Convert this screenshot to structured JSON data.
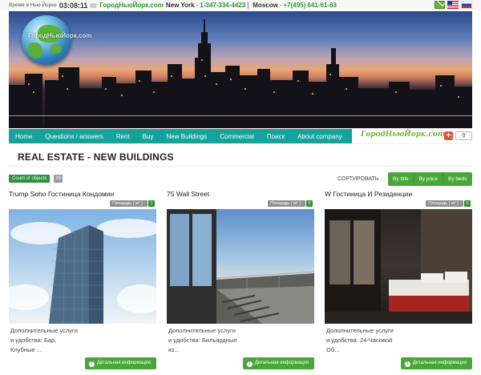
{
  "topbar": {
    "time_label": "Время в Нью Йорке",
    "time": "03:08:11",
    "site": "ГородНьюЙорк.com",
    "city1": "New York",
    "phone1": "1-347-334-4423",
    "separator": "|",
    "city2": "Moscow",
    "phone2": "+7(495) 641-61-63"
  },
  "banner": {
    "logo_text": "ГородНьюЙорк.com"
  },
  "nav": {
    "items": [
      "Home",
      "Questions / answers",
      "Rent",
      "Buy",
      "New Buildings",
      "Commercial",
      "Поиск",
      "About company"
    ],
    "brand": "ГородНьюЙорк.com",
    "plus": "+",
    "count": "0"
  },
  "page": {
    "heading": "REAL ESTATE - NEW BUILDINGS",
    "count_label": "Count of objects",
    "count_value": "29",
    "sort_label": "СОРТИРОВАТЬ :",
    "sort_buttons": [
      "By title",
      "By price",
      "By beds"
    ]
  },
  "cards": [
    {
      "title": "Trump Soho Гостиница Кондомин",
      "area_label": "Площадь ( м² ) :",
      "area_value": "1",
      "desc1": "Дополнительные услуги",
      "desc2": "и удобства: Бар,",
      "desc3": "Клубные ...",
      "details": "Детальная информация"
    },
    {
      "title": "75 Wall Street",
      "area_label": "Площадь ( м² ) :",
      "area_value": "0",
      "desc1": "Дополнительные услуги",
      "desc2": "и удобства: Бильярдные",
      "desc3": "ко...",
      "details": "Детальная информация"
    },
    {
      "title": "W Гостиница И Резиденции",
      "area_label": "Площадь ( м² ) :",
      "area_value": "0",
      "desc1": "Дополнительные услуги",
      "desc2": "и удобства: 24-Часовой",
      "desc3": "Об...",
      "details": "Детальная информация"
    }
  ],
  "colors": {
    "nav": "#14a29b",
    "green": "#4aa63a",
    "brand": "#7ab23a"
  },
  "icons": [
    "cloud-icon",
    "mail-icon",
    "flag-us-icon",
    "flag-ru-icon",
    "globe-logo-icon",
    "plus-icon",
    "info-icon"
  ]
}
